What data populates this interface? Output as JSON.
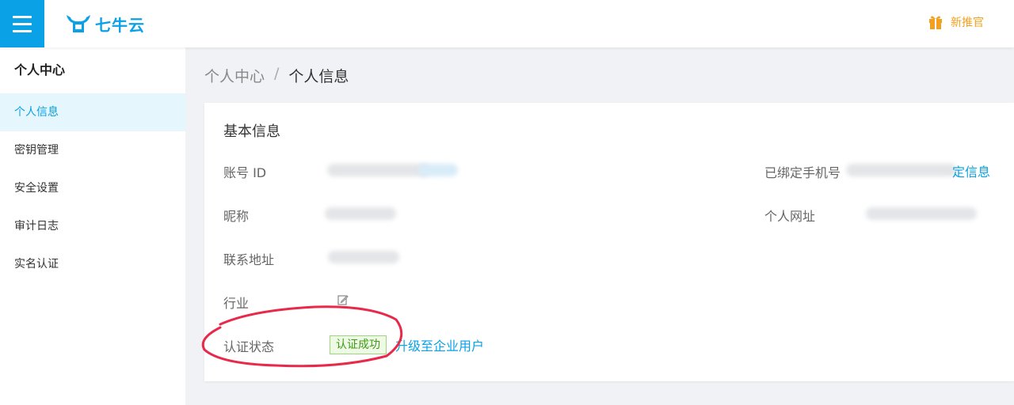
{
  "header": {
    "brand": "七牛云",
    "promo_label": "新推官"
  },
  "sidebar": {
    "title": "个人中心",
    "items": [
      {
        "label": "个人信息",
        "active": true
      },
      {
        "label": "密钥管理"
      },
      {
        "label": "安全设置"
      },
      {
        "label": "审计日志"
      },
      {
        "label": "实名认证"
      }
    ]
  },
  "breadcrumb": {
    "parent": "个人中心",
    "separator": "/",
    "current": "个人信息"
  },
  "basic_info": {
    "title": "基本信息",
    "labels": {
      "account_id": "账号 ID",
      "nickname": "昵称",
      "address": "联系地址",
      "industry": "行业",
      "verify_status": "认证状态",
      "phone": "已绑定手机号",
      "website": "个人网址"
    },
    "verify_badge": "认证成功",
    "upgrade_link": "升级至企业用户",
    "bind_link_partial": "定信息"
  },
  "colors": {
    "accent": "#0aa1e6",
    "success": "#3e9b14",
    "promo": "#f2a01f",
    "annotation": "#e8294a"
  },
  "icons": [
    "menu-icon",
    "logo-icon",
    "gift-icon",
    "edit-icon"
  ]
}
